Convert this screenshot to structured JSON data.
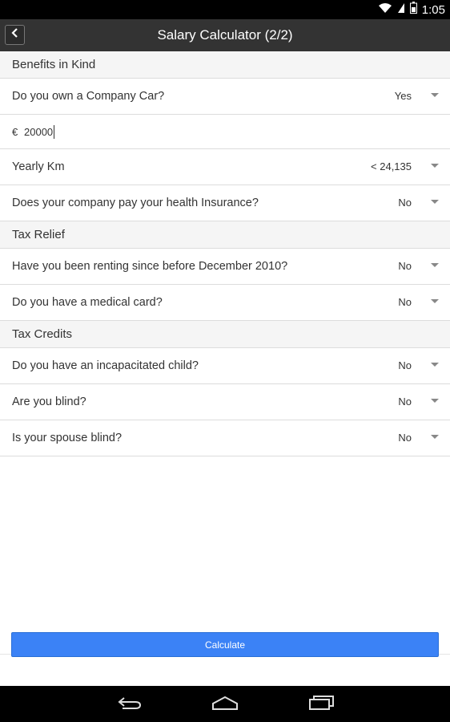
{
  "status_bar": {
    "time": "1:05"
  },
  "header": {
    "title": "Salary Calculator (2/2)"
  },
  "sections": {
    "benefits": {
      "title": "Benefits in Kind",
      "company_car": {
        "label": "Do you own a Company Car?",
        "value": "Yes"
      },
      "amount": {
        "currency": "€",
        "value": "20000"
      },
      "yearly_km": {
        "label": "Yearly Km",
        "value": "< 24,135"
      },
      "health_insurance": {
        "label": "Does your company pay your health Insurance?",
        "value": "No"
      }
    },
    "tax_relief": {
      "title": "Tax Relief",
      "renting": {
        "label": "Have you been renting since before December 2010?",
        "value": "No"
      },
      "medical_card": {
        "label": "Do you have a medical card?",
        "value": "No"
      }
    },
    "tax_credits": {
      "title": "Tax Credits",
      "incapacitated_child": {
        "label": "Do you have an incapacitated child?",
        "value": "No"
      },
      "blind": {
        "label": "Are you blind?",
        "value": "No"
      },
      "spouse_blind": {
        "label": "Is your spouse blind?",
        "value": "No"
      }
    }
  },
  "actions": {
    "calculate_label": "Calculate"
  },
  "colors": {
    "action_bar": "#333333",
    "button": "#3b82f6",
    "section_bg": "#f5f5f5"
  },
  "icons": [
    "wifi-icon",
    "signal-icon",
    "battery-icon",
    "back-chevron-icon",
    "dropdown-caret-icon",
    "nav-back-icon",
    "nav-home-icon",
    "nav-recents-icon"
  ]
}
